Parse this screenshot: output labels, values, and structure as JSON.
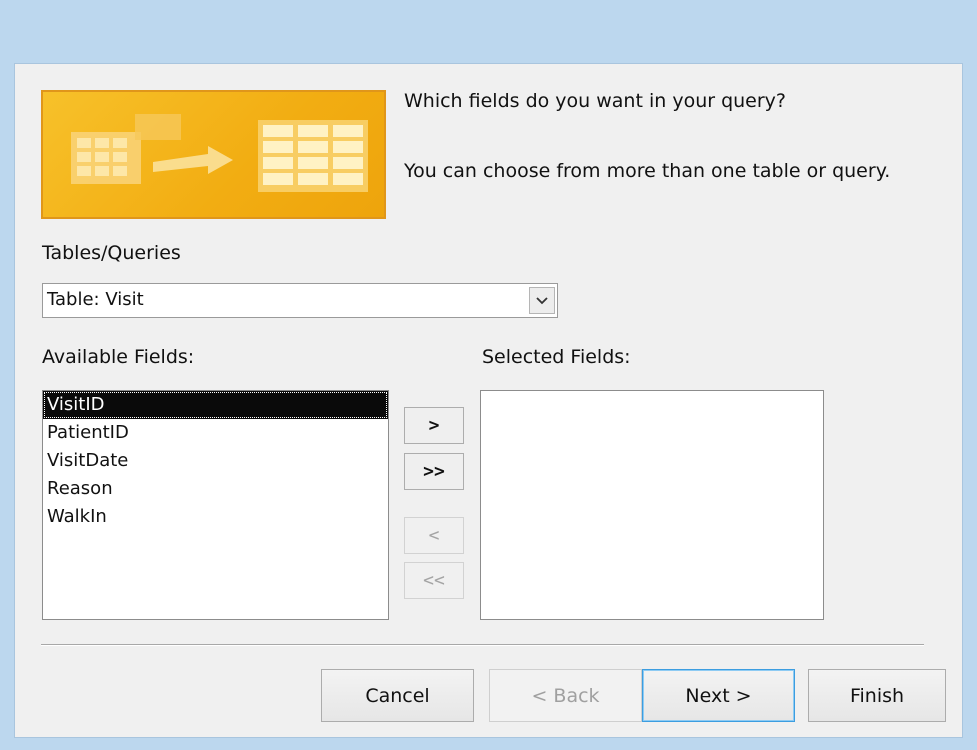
{
  "wizard": {
    "prompt": "Which fields do you want in your query?",
    "hint": "You can choose from more than one table or query."
  },
  "tables_queries": {
    "label": "Tables/Queries",
    "selected_value": "Table: Visit",
    "dropdown_icon": "chevron-down-icon"
  },
  "available_fields": {
    "label": "Available Fields:",
    "items": [
      "VisitID",
      "PatientID",
      "VisitDate",
      "Reason",
      "WalkIn"
    ],
    "selected_index": 0
  },
  "selected_fields": {
    "label": "Selected Fields:",
    "items": []
  },
  "move_buttons": {
    "add_one": ">",
    "add_all": ">>",
    "remove_one": "<",
    "remove_all": "<<"
  },
  "footer": {
    "cancel": "Cancel",
    "back": "< Back",
    "next": "Next >",
    "finish": "Finish"
  },
  "colors": {
    "window_frame": "#bcd7ee",
    "banner": "#f2ad12",
    "selection": "#0a0a0a",
    "default_button_border": "#3c9de0"
  }
}
